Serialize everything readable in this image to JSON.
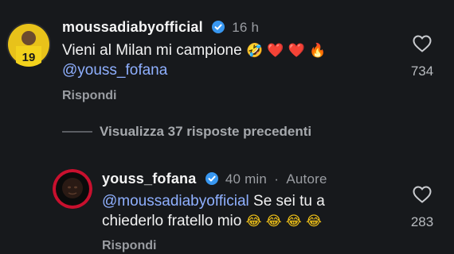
{
  "comment1": {
    "username": "moussadiabyofficial",
    "time": "16 h",
    "text": "Vieni al Milan mi campione",
    "emojis": [
      "🤣",
      "❤️",
      "❤️",
      "🔥"
    ],
    "mention": "@youss_fofana",
    "reply_label": "Rispondi",
    "likes": "734",
    "avatar_jersey_number": "19"
  },
  "thread": {
    "more_replies_label": "Visualizza 37 risposte precedenti"
  },
  "comment2": {
    "username": "youss_fofana",
    "time": "40 min",
    "author_tag": "Autore",
    "mention": "@moussadiabyofficial",
    "text_line1": "Se sei tu a",
    "text_line2": "chiederlo fratello mio",
    "emojis": [
      "😂",
      "😂",
      "😂",
      "😂"
    ],
    "reply_label": "Rispondi",
    "likes": "283"
  },
  "colors": {
    "background": "#17191c",
    "mention": "#8fb0ff",
    "verified": "#3897f0",
    "muted": "#9a9da2"
  }
}
